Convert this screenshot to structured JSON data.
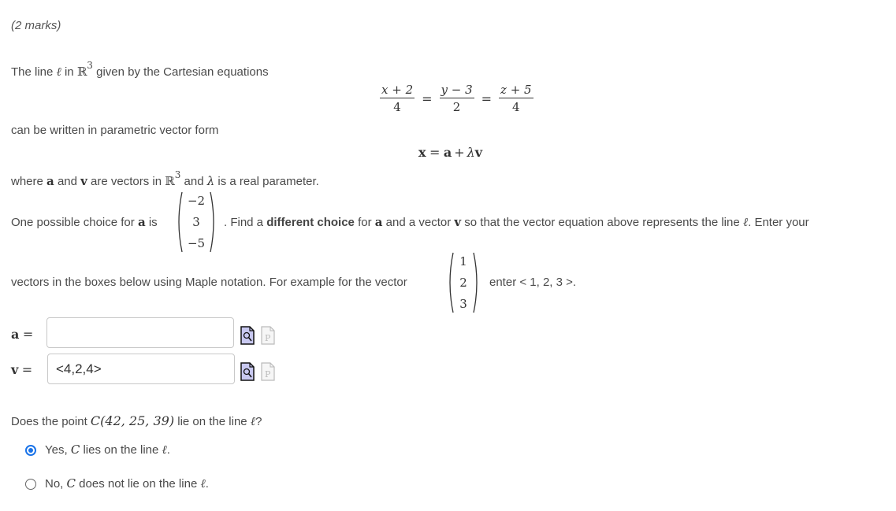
{
  "marks": "(2 marks)",
  "intro": {
    "part1": "The line",
    "ell": "ℓ",
    "part2": "in",
    "space": "ℝ",
    "dim": "3",
    "part3": "given by the Cartesian equations"
  },
  "cartesian": {
    "fractions": [
      {
        "num": "x + 2",
        "den": "4"
      },
      {
        "num": "y − 3",
        "den": "2"
      },
      {
        "num": "z + 5",
        "den": "4"
      }
    ],
    "equals": "="
  },
  "parametric_intro": "can be written in parametric vector form",
  "parametric_eq": {
    "x": "x",
    "eq": "=",
    "a": "a",
    "plus": "+",
    "lambda": "λ",
    "v": "v"
  },
  "where": {
    "p1": "where",
    "a": "a",
    "p2": "and",
    "v": "v",
    "p3": "are vectors in",
    "space": "ℝ",
    "dim": "3",
    "p4": "and",
    "lambda": "λ",
    "p5": "is a real parameter."
  },
  "choice": {
    "p1": "One possible choice for",
    "a": "a",
    "p2": "is",
    "vector": [
      "−2",
      "3",
      "−5"
    ],
    "p3": ".  Find a",
    "bold": "different choice",
    "p4": "for",
    "a2": "a",
    "p5": "and a vector",
    "v": "v",
    "p6": "so that the vector equation above represents the line",
    "ell": "ℓ",
    "p7": ".  Enter your"
  },
  "example": {
    "p1": "vectors in the boxes below using Maple notation.  For example for the vector",
    "vector": [
      "1",
      "2",
      "3"
    ],
    "p2": "enter < 1, 2, 3 >."
  },
  "inputs": [
    {
      "label_var": "a",
      "label_eq": "=",
      "value": "",
      "preview_icon": "preview-icon",
      "syntax_icon": "syntax-help-icon"
    },
    {
      "label_var": "v",
      "label_eq": "=",
      "value": "<4,2,4>",
      "preview_icon": "preview-icon",
      "syntax_icon": "syntax-help-icon"
    }
  ],
  "question": {
    "p1": "Does the point",
    "point": "C(42, 25, 39)",
    "p2": "lie on the line",
    "ell": "ℓ",
    "p3": "?"
  },
  "options": [
    {
      "p1": "Yes,",
      "c": "C",
      "p2": "lies on the line",
      "ell": "ℓ",
      "p3": ".",
      "selected": true
    },
    {
      "p1": "No,",
      "c": "C",
      "p2": "does not lie on the line",
      "ell": "ℓ",
      "p3": ".",
      "selected": false
    }
  ],
  "colors": {
    "radio_selected": "#1a73e8",
    "preview_icon_fill": "#c8c8f0"
  }
}
